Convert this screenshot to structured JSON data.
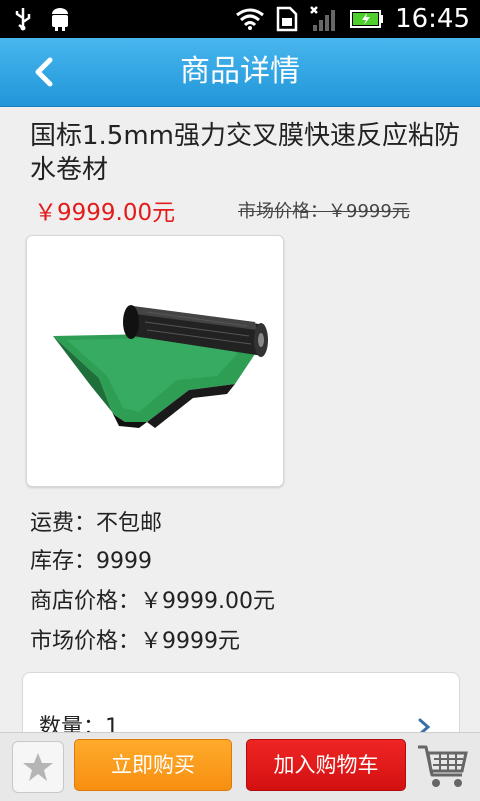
{
  "status_bar": {
    "time": "16:45",
    "icons": [
      "usb-icon",
      "android-debug-icon",
      "wifi-icon",
      "sim-icon",
      "signal-icon",
      "battery-charging-icon"
    ]
  },
  "header": {
    "title": "商品详情",
    "back_icon": "chevron-left-icon"
  },
  "product": {
    "name": "国标1.5mm强力交叉膜快速反应粘防水卷材",
    "price": "￥9999.00元",
    "market_price_strike": "市场价格：￥9999元",
    "image_desc": "product-image"
  },
  "info": {
    "shipping": "运费：不包邮",
    "stock": "库存：9999",
    "store_price": "商店价格：￥9999.00元",
    "market_price": "市场价格：￥9999元"
  },
  "quantity": {
    "label": "数量：1"
  },
  "bottom_bar": {
    "buy_now": "立即购买",
    "add_to_cart": "加入购物车"
  },
  "colors": {
    "header": "#2ba3e3",
    "price": "#e21b1b",
    "buy": "#f89a1a",
    "cart": "#e01818"
  }
}
